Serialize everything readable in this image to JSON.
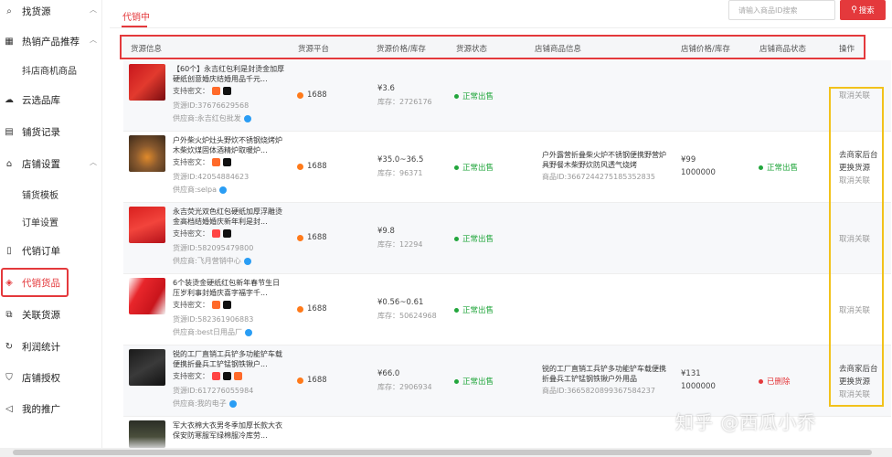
{
  "sidebar": {
    "items": [
      {
        "label": "找货源",
        "icon": "search-icon",
        "chevron": "up"
      },
      {
        "label": "热销产品推荐",
        "icon": "grid-icon",
        "chevron": "up"
      },
      {
        "label": "抖店商机商品",
        "sub": true
      },
      {
        "label": "云选品库",
        "icon": "cloud-icon"
      },
      {
        "label": "铺货记录",
        "icon": "document-icon"
      },
      {
        "label": "店铺设置",
        "icon": "store-icon",
        "chevron": "up"
      },
      {
        "label": "铺货模板",
        "sub": true
      },
      {
        "label": "订单设置",
        "sub": true
      },
      {
        "label": "代销订单",
        "icon": "phone-icon"
      },
      {
        "label": "代销货品",
        "icon": "box-icon",
        "active": true
      },
      {
        "label": "关联货源",
        "icon": "link-icon"
      },
      {
        "label": "利润统计",
        "icon": "refresh-icon"
      },
      {
        "label": "店铺授权",
        "icon": "shield-icon"
      },
      {
        "label": "我的推广",
        "icon": "megaphone-icon"
      }
    ]
  },
  "tabs": {
    "active": "代销中"
  },
  "search": {
    "placeholder": "请输入商品ID搜索",
    "button": "搜索"
  },
  "columns": [
    "货源信息",
    "货源平台",
    "货源价格/库存",
    "货源状态",
    "店铺商品信息",
    "店铺价格/库存",
    "店铺商品状态",
    "操作"
  ],
  "labels": {
    "support": "支持密文："
  },
  "rows": [
    {
      "name": "【60个】永吉红包利是封烫金加厚硬纸创意婚庆结婚用品千元...",
      "source_id": "货源ID:37676629568",
      "supplier": "供应商:永吉红包批发",
      "platform": "1688",
      "price": "¥3.6",
      "stock": "库存：2726176",
      "status": "正常出售",
      "shop_info": "",
      "shop_id": "",
      "shop_price": "",
      "shop_stock": "",
      "shop_status": "",
      "ops": [
        "取消关联"
      ]
    },
    {
      "name": "户外柴火炉灶头野炊不锈钢烧烤炉木柴炊煤固体酒精炉取暖炉...",
      "source_id": "货源ID:42054884623",
      "supplier": "供应商:selpa",
      "platform": "1688",
      "price": "¥35.0~36.5",
      "stock": "库存：96371",
      "status": "正常出售",
      "shop_info": "户外露营折叠柴火炉不锈钢便携野营炉具野餐木柴野炊防风透气烧烤",
      "shop_id": "商品ID:3667244275185352835",
      "shop_price": "¥99",
      "shop_stock": "1000000",
      "shop_status": "正常出售",
      "shop_status_color": "#22a63c",
      "ops": [
        "去商家后台",
        "更换货源",
        "取消关联"
      ]
    },
    {
      "name": "永吉荧光双色红包硬纸加厚浮雕烫金高档结婚婚庆新年利是封...",
      "source_id": "货源ID:582095479800",
      "supplier": "供应商:飞月营销中心",
      "platform": "1688",
      "price": "¥9.8",
      "stock": "库存：12294",
      "status": "正常出售",
      "shop_info": "",
      "shop_id": "",
      "shop_price": "",
      "shop_stock": "",
      "shop_status": "",
      "ops": [
        "取消关联"
      ]
    },
    {
      "name": "6个装烫金硬纸红包新年春节生日压岁利事封婚庆喜字福字千...",
      "source_id": "货源ID:582361906883",
      "supplier": "供应商:best日用品厂",
      "platform": "1688",
      "price": "¥0.56~0.61",
      "stock": "库存：50624968",
      "status": "正常出售",
      "shop_info": "",
      "shop_id": "",
      "shop_price": "",
      "shop_stock": "",
      "shop_status": "",
      "ops": [
        "取消关联"
      ]
    },
    {
      "name": "锐的工厂直销工兵铲多功能铲车载便携折叠兵工铲锰钢铁锹户...",
      "source_id": "货源ID:617276055984",
      "supplier": "供应商:我的电子",
      "platform": "1688",
      "price": "¥66.0",
      "stock": "库存：2906934",
      "status": "正常出售",
      "shop_info": "锐的工厂直销工兵铲多功能铲车载便携折叠兵工铲锰钢铁锹户外用品",
      "shop_id": "商品ID:3665820899367584237",
      "shop_price": "¥131",
      "shop_stock": "1000000",
      "shop_status": "已删除",
      "shop_status_color": "#e4393c",
      "ops": [
        "去商家后台",
        "更换货源",
        "取消关联"
      ]
    },
    {
      "name": "军大衣棉大衣男冬季加厚长款大衣保安防寒服军绿棉服冷库劳..."
    }
  ],
  "watermark": "知乎 @西瓜小乔",
  "colors": {
    "accent": "#e4393c",
    "success": "#22a63c",
    "highlight": "#f2c21b",
    "platform": "#ff7a1a"
  }
}
